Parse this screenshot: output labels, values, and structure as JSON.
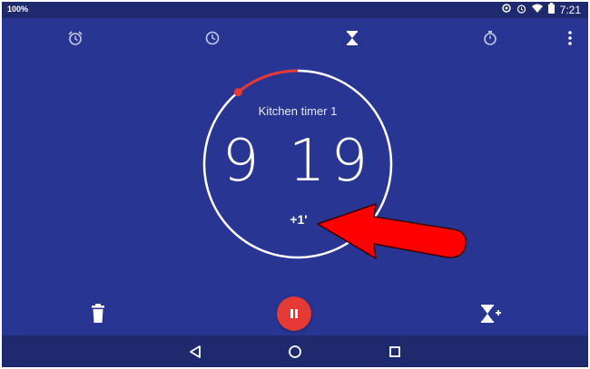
{
  "status_bar": {
    "left_text": "100%",
    "time": "7:21",
    "icons": [
      "sync-icon",
      "alarm-icon",
      "wifi-icon",
      "battery-icon"
    ]
  },
  "tabs": [
    {
      "id": "alarm",
      "icon": "alarm-clock-icon",
      "active": false
    },
    {
      "id": "clock",
      "icon": "clock-icon",
      "active": false
    },
    {
      "id": "timer",
      "icon": "hourglass-icon",
      "active": true
    },
    {
      "id": "stopwatch",
      "icon": "stopwatch-icon",
      "active": false
    }
  ],
  "overflow_menu": {
    "icon": "more-vert-icon"
  },
  "timer": {
    "label": "Kitchen timer 1",
    "value": "9 19",
    "add_minute_label": "+1'",
    "remaining_fraction": 0.89
  },
  "controls": {
    "delete_icon": "trash-icon",
    "pause_icon": "pause-icon",
    "add_timer_icon": "add-timer-icon"
  },
  "nav_bar": {
    "back_icon": "back-icon",
    "home_icon": "home-icon",
    "recents_icon": "recents-icon"
  },
  "colors": {
    "background": "#283593",
    "bars": "#1f2a6e",
    "accent": "#e53935",
    "annotation_arrow": "#ff0000"
  }
}
